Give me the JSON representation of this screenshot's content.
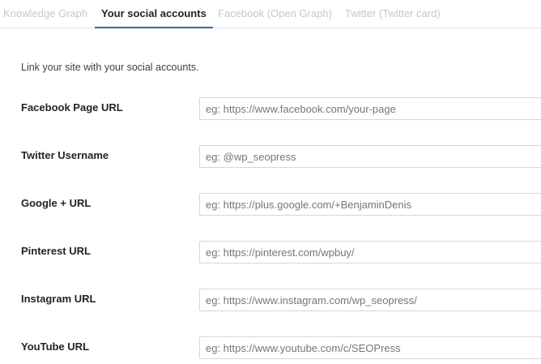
{
  "tabs": [
    {
      "label": "Knowledge Graph",
      "active": false
    },
    {
      "label": "Your social accounts",
      "active": true
    },
    {
      "label": "Facebook (Open Graph)",
      "active": false
    },
    {
      "label": "Twitter (Twitter card)",
      "active": false
    }
  ],
  "intro": "Link your site with your social accounts.",
  "fields": [
    {
      "label": "Facebook Page URL",
      "value": "",
      "placeholder": "eg: https://www.facebook.com/your-page"
    },
    {
      "label": "Twitter Username",
      "value": "",
      "placeholder": "eg: @wp_seopress"
    },
    {
      "label": "Google + URL",
      "value": "",
      "placeholder": "eg: https://plus.google.com/+BenjaminDenis"
    },
    {
      "label": "Pinterest URL",
      "value": "",
      "placeholder": "eg: https://pinterest.com/wpbuy/"
    },
    {
      "label": "Instagram URL",
      "value": "",
      "placeholder": "eg: https://www.instagram.com/wp_seopress/"
    },
    {
      "label": "YouTube URL",
      "value": "",
      "placeholder": "eg: https://www.youtube.com/c/SEOPress"
    }
  ],
  "colors": {
    "accent": "#2271b1",
    "inactive_tab": "#c5c8cc"
  }
}
